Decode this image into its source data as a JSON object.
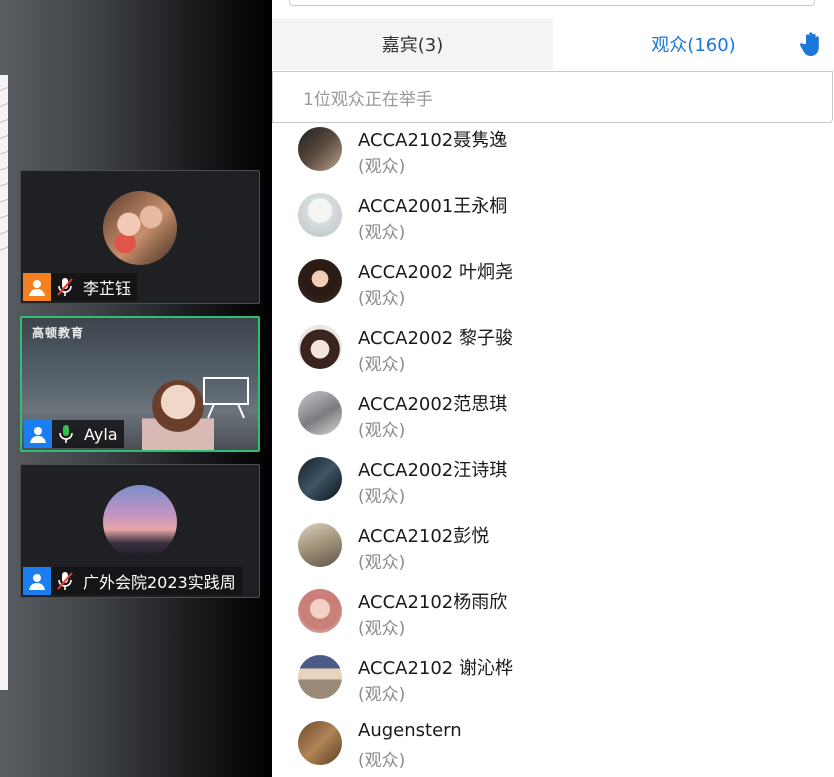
{
  "video_tiles": [
    {
      "name": "李芷钰",
      "role_color": "#f5801f",
      "mic": "muted",
      "type": "avatar"
    },
    {
      "name": "Ayla",
      "role_color": "#1a7ef0",
      "mic": "on",
      "type": "video",
      "logo_text": "高顿教育"
    },
    {
      "name": "广外会院2023实践周",
      "role_color": "#1a7ef0",
      "mic": "muted",
      "type": "avatar"
    }
  ],
  "tabs": {
    "guests": "嘉宾(3)",
    "audience": "观众(160)",
    "active": "audience"
  },
  "raise_hand_notice": "1位观众正在举手",
  "participants": [
    {
      "name": "ACCA2102聂隽逸",
      "role": "(观众)"
    },
    {
      "name": "ACCA2001王永桐",
      "role": "(观众)"
    },
    {
      "name": "ACCA2002 叶炯尧",
      "role": "(观众)"
    },
    {
      "name": "ACCA2002 黎子骏",
      "role": "(观众)"
    },
    {
      "name": "ACCA2002范思琪",
      "role": "(观众)"
    },
    {
      "name": "ACCA2002汪诗琪",
      "role": "(观众)"
    },
    {
      "name": "ACCA2102彭悦",
      "role": "(观众)"
    },
    {
      "name": "ACCA2102杨雨欣",
      "role": "(观众)"
    },
    {
      "name": "ACCA2102 谢沁桦",
      "role": "(观众)"
    },
    {
      "name": "Augenstern",
      "role": "(观众)"
    }
  ],
  "colors": {
    "accent": "#1b77d9",
    "active_tile_border": "#2fbf71",
    "mic_on": "#31c24d"
  }
}
